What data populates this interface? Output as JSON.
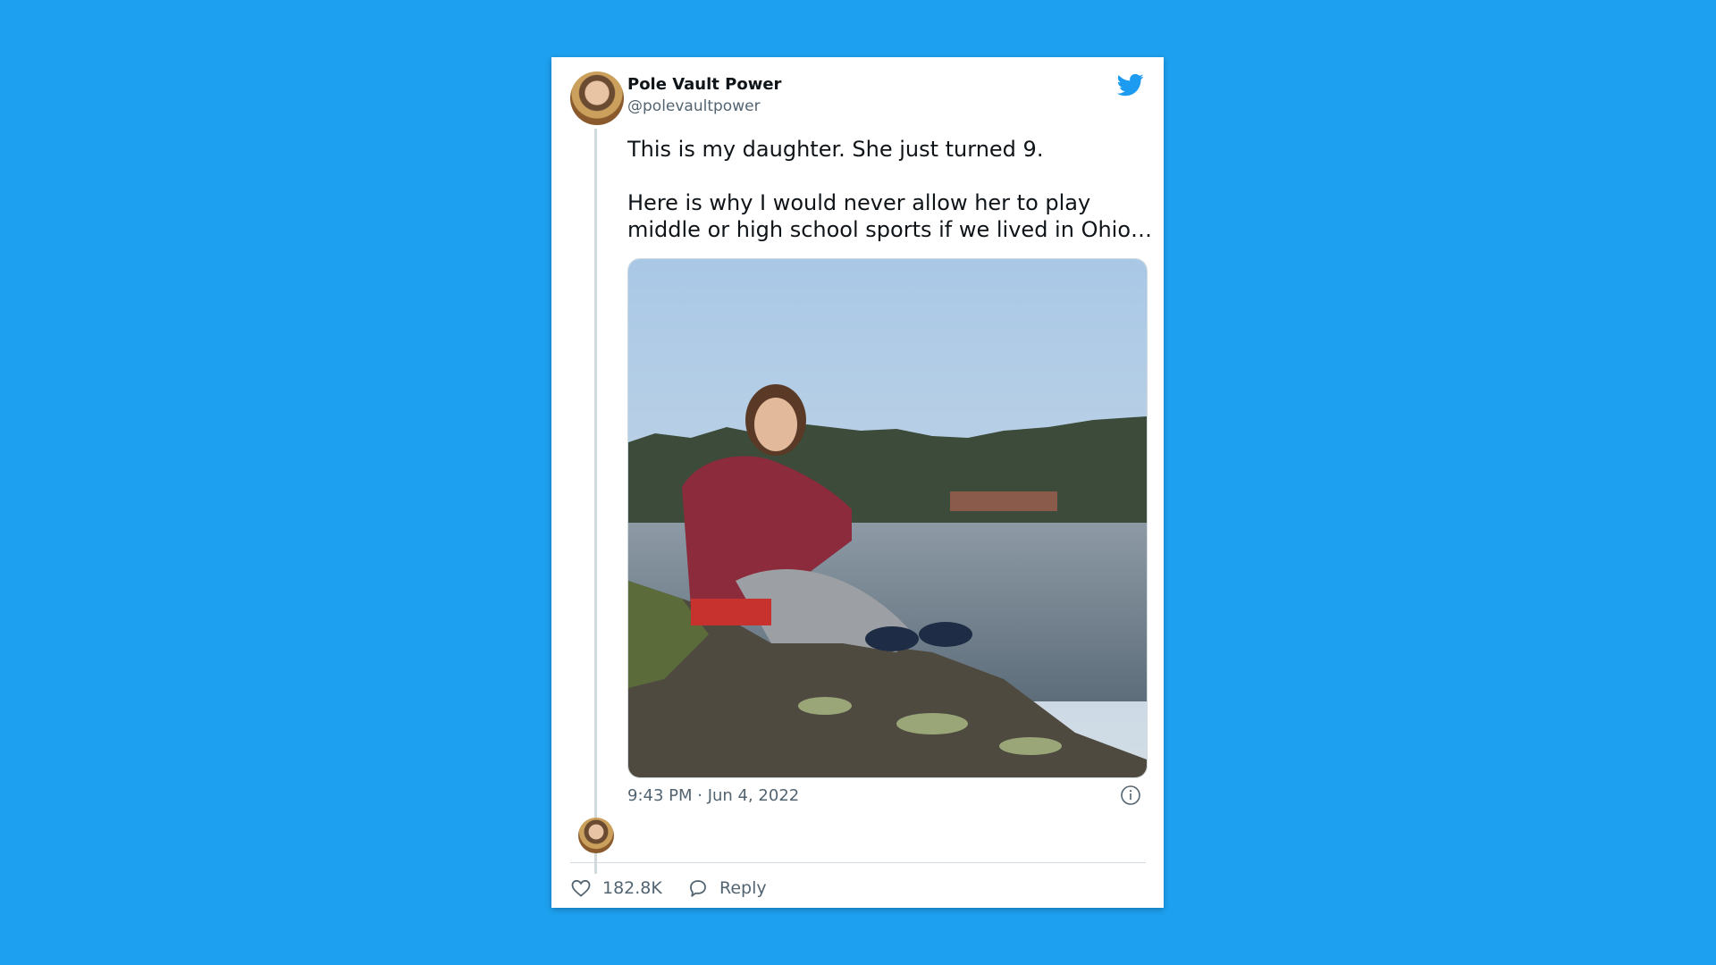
{
  "tweet": {
    "author_name": "Pole Vault Power",
    "author_handle": "@polevaultpower",
    "text": "This is my daughter. She just turned 9.\n\nHere is why I would never allow her to play middle or high school sports if we lived in Ohio…",
    "timestamp": "9:43 PM · Jun 4, 2022",
    "likes": "182.8K",
    "reply_label": "Reply"
  },
  "icons": {
    "brand": "twitter-bird-icon",
    "info": "info-icon",
    "like": "heart-icon",
    "reply": "speech-bubble-icon"
  },
  "colors": {
    "background": "#1da0ef",
    "brand_blue": "#1d9bf0",
    "text": "#0f1419",
    "secondary_text": "#536471"
  }
}
